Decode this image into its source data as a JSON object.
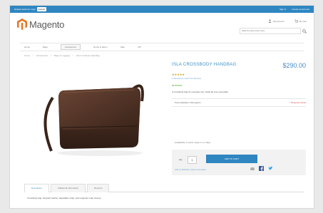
{
  "topbar": {
    "store_label": "Default welcome msg!",
    "store_value": "Default",
    "sign_in": "Sign In",
    "register": "Create an Account"
  },
  "header": {
    "logo_text": "Magento",
    "my_account": "My Account",
    "cart": "My Cart",
    "search_placeholder": "Search entire store here..."
  },
  "nav": {
    "items": [
      "Home",
      "Bags",
      "Accessories",
      "Home & Decor",
      "Sale",
      "VIP"
    ]
  },
  "breadcrumb": {
    "items": [
      "Home",
      "Accessories",
      "Bags & Luggage",
      "Isla Crossbody Handbag"
    ]
  },
  "product": {
    "title": "ISLA CROSSBODY HANDBAG",
    "price": "$290.00",
    "stars": "★★★★★",
    "review_text": "1 Review(s) | Add Your Review",
    "stock": "IN STOCK",
    "description": "A crossbody bag for everyday use; holds all your essentials.",
    "personal_label": "Personalization: Monogram",
    "required_note": "* Required Fields",
    "ship_note": "Availability: In stock, ships in 1-2 days",
    "qty_label": "Qty",
    "qty_value": "1",
    "add_to_cart": "ADD TO CART",
    "share_label": "Add to Wishlist | Add to Compare"
  },
  "tabs": {
    "items": [
      "Description",
      "Additional Information",
      "Reviews"
    ],
    "content": "Crossbody bag: full-grain leather, adjustable strap, and magnetic snap closure."
  },
  "colors": {
    "primary": "#2f86c1",
    "logo_orange": "#e9731e",
    "stock_green": "#6bb24b"
  }
}
